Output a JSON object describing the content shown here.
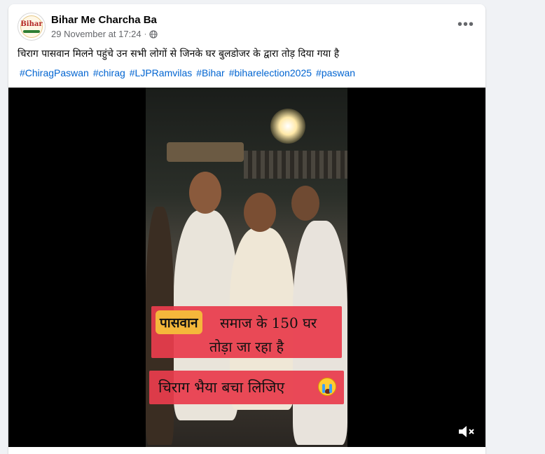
{
  "post": {
    "page_name": "Bihar Me Charcha Ba",
    "avatar_text": "Bihar",
    "timestamp": "29 November at 17:24",
    "separator": "·",
    "privacy_icon": "globe-icon",
    "more_icon": "more-dots-icon",
    "more_label": "•••",
    "caption": "चिराग पासवान मिलने पहुंचे उन सभी लोगों से जिनके घर बुलडोजर के द्वारा तोड़ दिया गया है",
    "hashtags": [
      "#ChiragPaswan",
      "#chirag",
      "#LJPRamvilas",
      "#Bihar",
      "#biharelection2025",
      "#paswan"
    ]
  },
  "video": {
    "overlay_badge": "पासवान",
    "overlay_line1": "समाज के 150 घर",
    "overlay_line2": "तोड़ा जा रहा है",
    "overlay_line3": "चिराग भैया बचा लिजिए",
    "emoji_icon": "crying-face-icon",
    "mute_icon": "volume-muted-icon"
  },
  "colors": {
    "link": "#0064d1",
    "overlay_red": "#e83c4c",
    "badge_yellow": "#f5b73b",
    "card_bg": "#ffffff",
    "page_bg": "#f0f2f5"
  }
}
